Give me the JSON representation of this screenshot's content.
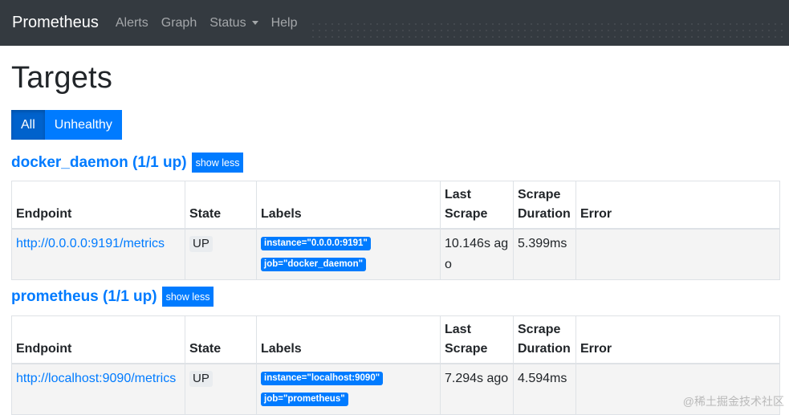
{
  "navbar": {
    "brand": "Prometheus",
    "items": [
      {
        "label": "Alerts"
      },
      {
        "label": "Graph"
      },
      {
        "label": "Status"
      },
      {
        "label": "Help"
      }
    ]
  },
  "page": {
    "title": "Targets",
    "filters": {
      "all": "All",
      "unhealthy": "Unhealthy"
    }
  },
  "columns": {
    "endpoint": "Endpoint",
    "state": "State",
    "labels": "Labels",
    "last_scrape_1": "Last",
    "last_scrape_2": "Scrape",
    "duration_1": "Scrape",
    "duration_2": "Duration",
    "error": "Error"
  },
  "pools": [
    {
      "title": "docker_daemon (1/1 up)",
      "toggle": "show less",
      "target": {
        "endpoint": "http://0.0.0.0:9191/metrics",
        "state": "UP",
        "label_instance": "instance=\"0.0.0.0:9191\"",
        "label_job": "job=\"docker_daemon\"",
        "last_scrape": "10.146s ago",
        "duration": "5.399ms",
        "error": ""
      }
    },
    {
      "title": "prometheus (1/1 up)",
      "toggle": "show less",
      "target": {
        "endpoint": "http://localhost:9090/metrics",
        "state": "UP",
        "label_instance": "instance=\"localhost:9090\"",
        "label_job": "job=\"prometheus\"",
        "last_scrape": "7.294s ago",
        "duration": "4.594ms",
        "error": ""
      }
    }
  ],
  "watermark": "@稀土掘金技术社区",
  "colors": {
    "navbar": "#343a40",
    "primary": "#007bff",
    "badge_gray": "#e9ecef"
  }
}
